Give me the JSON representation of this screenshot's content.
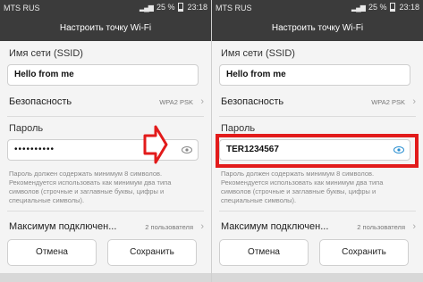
{
  "left": {
    "status": {
      "carrier": "MTS RUS",
      "battery": "25 %",
      "time": "23:18"
    },
    "title": "Настроить точку Wi-Fi",
    "ssid_label": "Имя сети (SSID)",
    "ssid_value": "Hello from me",
    "security_label": "Безопасность",
    "security_value": "WPA2 PSK",
    "password_label": "Пароль",
    "password_value": "••••••••••",
    "hint": "Пароль должен содержать минимум 8 символов. Рекомендуется использовать как минимум два типа символов (строчные и заглавные буквы, цифры и специальные символы).",
    "max_label": "Максимум подключен...",
    "max_value": "2 пользователя",
    "cancel": "Отмена",
    "save": "Сохранить"
  },
  "right": {
    "status": {
      "carrier": "MTS RUS",
      "battery": "25 %",
      "time": "23:18"
    },
    "title": "Настроить точку Wi-Fi",
    "ssid_label": "Имя сети (SSID)",
    "ssid_value": "Hello from me",
    "security_label": "Безопасность",
    "security_value": "WPA2 PSK",
    "password_label": "Пароль",
    "password_value": "TER1234567",
    "hint": "Пароль должен содержать минимум 8 символов. Рекомендуется использовать как минимум два типа символов (строчные и заглавные буквы, цифры и специальные символы).",
    "max_label": "Максимум подключен...",
    "max_value": "2 пользователя",
    "cancel": "Отмена",
    "save": "Сохранить"
  },
  "colors": {
    "accent_red": "#e21b1b",
    "eye_active": "#2a8fd1",
    "eye_inactive": "#888888"
  },
  "icons": {
    "visibility_toggle": "eye-icon",
    "arrow": "arrow-right-icon"
  }
}
